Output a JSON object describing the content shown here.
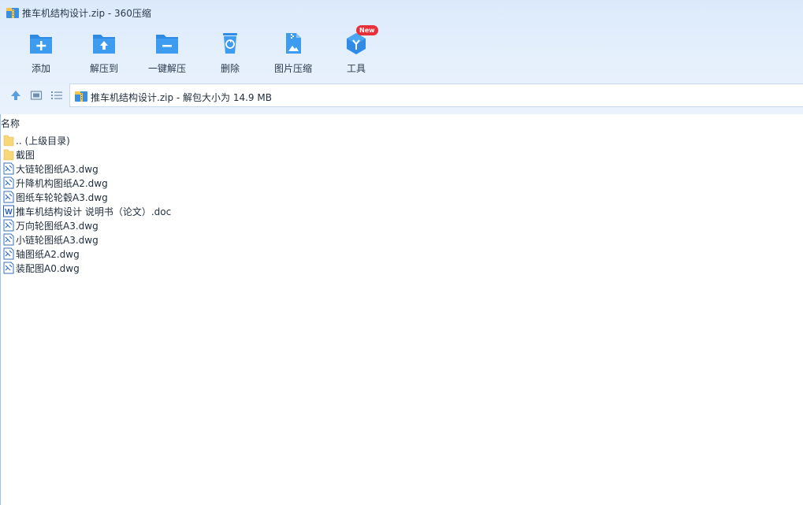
{
  "window": {
    "title": "推车机结构设计.zip - 360压缩"
  },
  "toolbar": {
    "items": [
      {
        "label": "添加",
        "icon": "folder-add-icon"
      },
      {
        "label": "解压到",
        "icon": "folder-extract-icon"
      },
      {
        "label": "一键解压",
        "icon": "one-click-extract-icon"
      },
      {
        "label": "删除",
        "icon": "trash-icon"
      },
      {
        "label": "图片压缩",
        "icon": "image-compress-icon"
      },
      {
        "label": "工具",
        "icon": "tools-cube-icon",
        "badge": "New"
      }
    ]
  },
  "address": {
    "path": "推车机结构设计.zip - 解包大小为 14.9 MB"
  },
  "list": {
    "column_name": "名称",
    "files": [
      {
        "name": ".. (上级目录)",
        "type": "folder"
      },
      {
        "name": "截图",
        "type": "folder"
      },
      {
        "name": "大链轮图纸A3.dwg",
        "type": "dwg"
      },
      {
        "name": "升降机构图纸A2.dwg",
        "type": "dwg"
      },
      {
        "name": "图纸车轮轮毂A3.dwg",
        "type": "dwg"
      },
      {
        "name": "推车机结构设计 说明书（论文）.doc",
        "type": "doc"
      },
      {
        "name": "万向轮图纸A3.dwg",
        "type": "dwg"
      },
      {
        "name": "小链轮图纸A3.dwg",
        "type": "dwg"
      },
      {
        "name": "轴图纸A2.dwg",
        "type": "dwg"
      },
      {
        "name": "装配图A0.dwg",
        "type": "dwg"
      }
    ]
  },
  "colors": {
    "accent": "#2f8be6",
    "badge": "#e8303a",
    "folder": "#f7d77a"
  }
}
